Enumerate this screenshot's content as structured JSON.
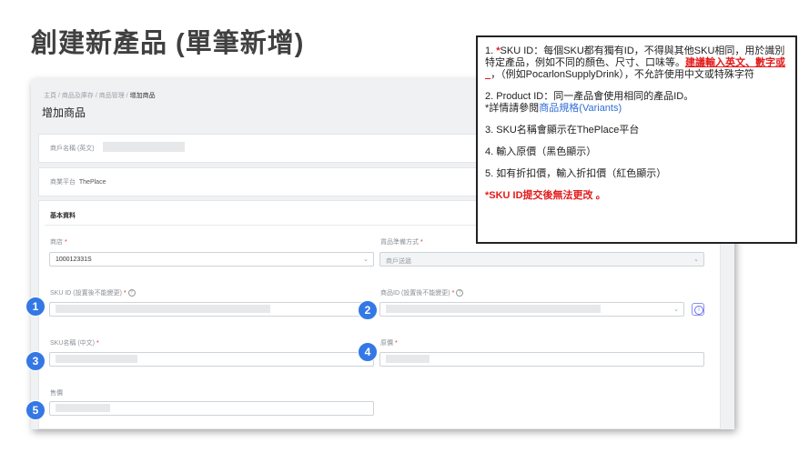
{
  "page_title": "創建新產品 (單筆新增)",
  "breadcrumb": {
    "items": [
      "主頁",
      "商品及庫存",
      "商品管理"
    ],
    "current": "增加商品",
    "separator": "/"
  },
  "form_title": "增加商品",
  "merchant": {
    "label": "商戶名稱 (英文)"
  },
  "platform": {
    "label": "商業平台",
    "value": "ThePlace"
  },
  "basic_section": "基本資料",
  "shop": {
    "label": "商店",
    "value": "100012331S"
  },
  "goods_prep": {
    "label": "貨品準備方式",
    "value": "商戶送遞"
  },
  "sku_id": {
    "label": "SKU ID (設置後不能變更)"
  },
  "product_id": {
    "label": "商品ID (設置後不能變更)"
  },
  "sku_name": {
    "label": "SKU名稱 (中文)"
  },
  "original_price": {
    "label": "原價"
  },
  "sale_price": {
    "label": "售價"
  },
  "markers": [
    "1",
    "2",
    "3",
    "4",
    "5"
  ],
  "notes": {
    "n1_a": "1. ",
    "n1_b": "*",
    "n1_c": "SKU ID：每個SKU都有獨有ID，不得與其他SKU相同，用於識別特定產品，例如不同的顏色、尺寸、口味等。",
    "n1_d": "建議輸入英文、數字或_",
    "n1_e": "，（例如PocarlonSupplyDrink），不允許使用中文或特殊字符",
    "n2_a": "2. Product ID：同一產品會使用相同的產品ID。",
    "n2_b": "*詳情請參閱",
    "n2_link": "商品規格(Variants)",
    "n3": "3. SKU名稱會顯示在ThePlace平台",
    "n4": "4. 輸入原價（黑色顯示）",
    "n5": "5. 如有折扣價，輸入折扣價（紅色顯示）",
    "warning": "*SKU ID提交後無法更改 。"
  },
  "colors": {
    "accent": "#3478e5",
    "required": "#e5322d",
    "warning": "#e31b1b",
    "link": "#2f6fd6"
  }
}
